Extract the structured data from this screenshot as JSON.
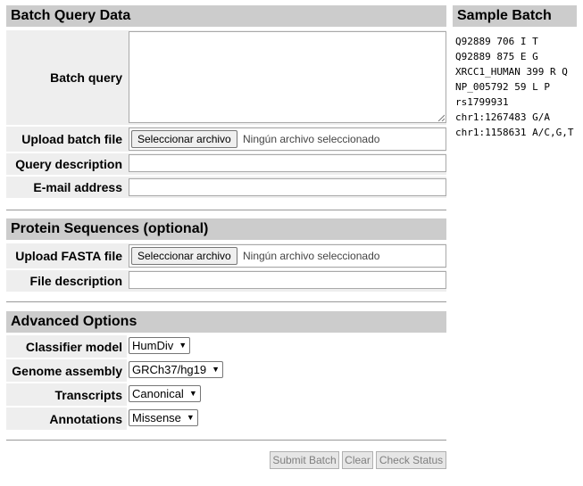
{
  "batch_section": {
    "title": "Batch Query Data",
    "batch_query_label": "Batch query",
    "batch_query_value": "",
    "upload_batch_label": "Upload batch file",
    "upload_button_label": "Seleccionar archivo",
    "upload_status": "Ningún archivo seleccionado",
    "query_description_label": "Query description",
    "query_description_value": "",
    "email_label": "E-mail address",
    "email_value": ""
  },
  "protein_section": {
    "title": "Protein Sequences (optional)",
    "upload_fasta_label": "Upload FASTA file",
    "upload_button_label": "Seleccionar archivo",
    "upload_status": "Ningún archivo seleccionado",
    "file_description_label": "File description",
    "file_description_value": ""
  },
  "advanced_section": {
    "title": "Advanced Options",
    "classifier_label": "Classifier model",
    "classifier_value": "HumDiv",
    "genome_label": "Genome assembly",
    "genome_value": "GRCh37/hg19",
    "transcripts_label": "Transcripts",
    "transcripts_value": "Canonical",
    "annotations_label": "Annotations",
    "annotations_value": "Missense"
  },
  "actions": {
    "submit_label": "Submit Batch",
    "clear_label": "Clear",
    "check_label": "Check Status"
  },
  "sample_batch": {
    "title": "Sample Batch",
    "lines": [
      "Q92889 706 I T",
      "Q92889 875 E G",
      "XRCC1_HUMAN 399 R Q",
      "NP_005792 59 L P",
      "rs1799931",
      "chr1:1267483 G/A",
      "chr1:1158631 A/C,G,T"
    ]
  },
  "colors": {
    "header_bg": "#cccccc",
    "row_bg": "#eeeeee",
    "divider": "#999999"
  }
}
